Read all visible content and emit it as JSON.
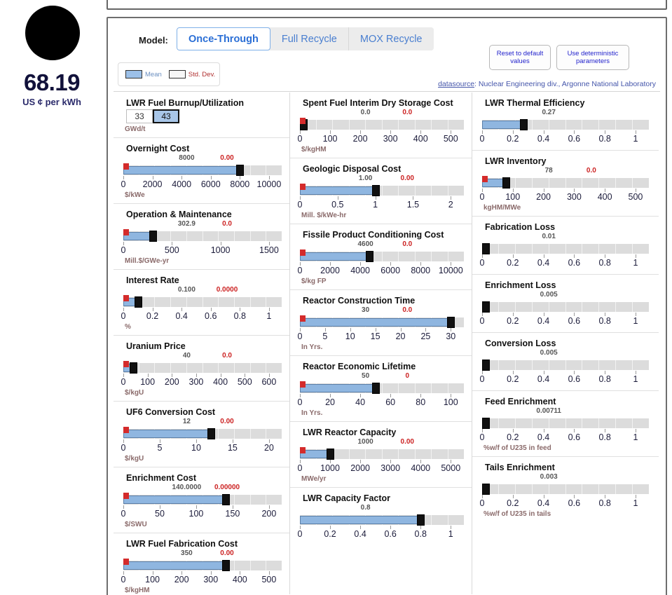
{
  "result": {
    "value": "68.19",
    "unit": "US ¢ per kWh"
  },
  "header": {
    "model_label": "Model:",
    "models": [
      {
        "label": "Once-Through",
        "active": true
      },
      {
        "label": "Full Recycle",
        "active": false
      },
      {
        "label": "MOX Recycle",
        "active": false
      }
    ],
    "reset_button": "Reset to default values",
    "deterministic_button": "Use deterministic parameters"
  },
  "legend": {
    "mean_label": "Mean",
    "stddev_label": "Std. Dev.",
    "mean_color": "#9cc0e8",
    "stddev_color": "#ffffff"
  },
  "datasource": {
    "link_text": "datasource",
    "text": ": Nuclear Engineering div., Argonne National Laboratory"
  },
  "chart_data": {
    "type": "bar",
    "title": "Nuclear Fuel Cycle Cost Parameters",
    "columns": [
      {
        "name": "column-1",
        "params": [
          {
            "title": "LWR Fuel Burnup/Utilization",
            "kind": "stepper",
            "options": [
              "33",
              "43"
            ],
            "selected": "43",
            "units": "GWd/t"
          },
          {
            "title": "Overnight Cost",
            "kind": "slider",
            "mean": "8000",
            "mean_num": 8000,
            "sd": "0.00",
            "sd_num": 0,
            "min": 0,
            "max": 10000,
            "ticks": [
              "0",
              "2000",
              "4000",
              "6000",
              "8000",
              "10000"
            ],
            "tick_vals": [
              0,
              2000,
              4000,
              6000,
              8000,
              10000
            ],
            "units": "$/kWe"
          },
          {
            "title": "Operation & Maintenance",
            "kind": "slider",
            "mean": "302.9",
            "mean_num": 302.9,
            "sd": "0.0",
            "sd_num": 0,
            "min": 0,
            "max": 1500,
            "ticks": [
              "0",
              "500",
              "1000",
              "1500"
            ],
            "tick_vals": [
              0,
              500,
              1000,
              1500
            ],
            "units": "Mill.$/GWe-yr"
          },
          {
            "title": "Interest Rate",
            "kind": "slider",
            "mean": "0.100",
            "mean_num": 0.1,
            "sd": "0.0000",
            "sd_num": 0,
            "min": 0,
            "max": 1,
            "ticks": [
              "0",
              "0.2",
              "0.4",
              "0.6",
              "0.8",
              "1"
            ],
            "tick_vals": [
              0,
              0.2,
              0.4,
              0.6,
              0.8,
              1
            ],
            "units": "%"
          },
          {
            "title": "Uranium Price",
            "kind": "slider",
            "mean": "40",
            "mean_num": 40,
            "sd": "0.0",
            "sd_num": 0,
            "min": 0,
            "max": 600,
            "ticks": [
              "0",
              "100",
              "200",
              "300",
              "400",
              "500",
              "600"
            ],
            "tick_vals": [
              0,
              100,
              200,
              300,
              400,
              500,
              600
            ],
            "units": "$/kgU"
          },
          {
            "title": "UF6 Conversion Cost",
            "kind": "slider",
            "mean": "12",
            "mean_num": 12,
            "sd": "0.00",
            "sd_num": 0,
            "min": 0,
            "max": 20,
            "ticks": [
              "0",
              "5",
              "10",
              "15",
              "20"
            ],
            "tick_vals": [
              0,
              5,
              10,
              15,
              20
            ],
            "units": "$/kgU"
          },
          {
            "title": "Enrichment Cost",
            "kind": "slider",
            "mean": "140.0000",
            "mean_num": 140,
            "sd": "0.00000",
            "sd_num": 0,
            "min": 0,
            "max": 200,
            "ticks": [
              "0",
              "50",
              "100",
              "150",
              "200"
            ],
            "tick_vals": [
              0,
              50,
              100,
              150,
              200
            ],
            "units": "$/SWU"
          },
          {
            "title": "LWR Fuel Fabrication Cost",
            "kind": "slider",
            "mean": "350",
            "mean_num": 350,
            "sd": "0.00",
            "sd_num": 0,
            "min": 0,
            "max": 500,
            "ticks": [
              "0",
              "100",
              "200",
              "300",
              "400",
              "500"
            ],
            "tick_vals": [
              0,
              100,
              200,
              300,
              400,
              500
            ],
            "units": "$/kgHM"
          }
        ]
      },
      {
        "name": "column-2",
        "params": [
          {
            "title": "Spent Fuel Interim Dry Storage Cost",
            "kind": "slider",
            "mean": "0.0",
            "mean_num": 0,
            "sd": "0.0",
            "sd_num": 0,
            "min": 0,
            "max": 500,
            "ticks": [
              "0",
              "100",
              "200",
              "300",
              "400",
              "500"
            ],
            "tick_vals": [
              0,
              100,
              200,
              300,
              400,
              500
            ],
            "units": "$/kgHM"
          },
          {
            "title": "Geologic Disposal Cost",
            "kind": "slider",
            "mean": "1.00",
            "mean_num": 1,
            "sd": "0.00",
            "sd_num": 0,
            "min": 0,
            "max": 2,
            "ticks": [
              "0",
              "0.5",
              "1",
              "1.5",
              "2"
            ],
            "tick_vals": [
              0,
              0.5,
              1,
              1.5,
              2
            ],
            "units": "Mill. $/kWe-hr"
          },
          {
            "title": "Fissile Product Conditioning Cost",
            "kind": "slider",
            "mean": "4600",
            "mean_num": 4600,
            "sd": "0.0",
            "sd_num": 0,
            "min": 0,
            "max": 10000,
            "ticks": [
              "0",
              "2000",
              "4000",
              "6000",
              "8000",
              "10000"
            ],
            "tick_vals": [
              0,
              2000,
              4000,
              6000,
              8000,
              10000
            ],
            "units": "$/kg FP"
          },
          {
            "title": "Reactor Construction Time",
            "kind": "slider",
            "mean": "30",
            "mean_num": 30,
            "sd": "0.0",
            "sd_num": 0,
            "min": 0,
            "max": 30,
            "ticks": [
              "0",
              "5",
              "10",
              "15",
              "20",
              "25",
              "30"
            ],
            "tick_vals": [
              0,
              5,
              10,
              15,
              20,
              25,
              30
            ],
            "units": "In Yrs."
          },
          {
            "title": "Reactor Economic Lifetime",
            "kind": "slider",
            "mean": "50",
            "mean_num": 50,
            "sd": "0",
            "sd_num": 0,
            "min": 0,
            "max": 100,
            "ticks": [
              "0",
              "20",
              "40",
              "60",
              "80",
              "100"
            ],
            "tick_vals": [
              0,
              20,
              40,
              60,
              80,
              100
            ],
            "units": "In Yrs."
          },
          {
            "title": "LWR Reactor Capacity",
            "kind": "slider",
            "mean": "1000",
            "mean_num": 1000,
            "sd": "0.00",
            "sd_num": 0,
            "min": 0,
            "max": 5000,
            "ticks": [
              "0",
              "1000",
              "2000",
              "3000",
              "4000",
              "5000"
            ],
            "tick_vals": [
              0,
              1000,
              2000,
              3000,
              4000,
              5000
            ],
            "units": "MWe/yr"
          },
          {
            "title": "LWR Capacity Factor",
            "kind": "slider",
            "mean": "0.8",
            "mean_num": 0.8,
            "sd": null,
            "sd_num": null,
            "min": 0,
            "max": 1,
            "ticks": [
              "0",
              "0.2",
              "0.4",
              "0.6",
              "0.8",
              "1"
            ],
            "tick_vals": [
              0,
              0.2,
              0.4,
              0.6,
              0.8,
              1
            ],
            "units": ""
          }
        ]
      },
      {
        "name": "column-3",
        "params": [
          {
            "title": "LWR Thermal Efficiency",
            "kind": "slider",
            "mean": "0.27",
            "mean_num": 0.27,
            "sd": null,
            "sd_num": null,
            "min": 0,
            "max": 1,
            "ticks": [
              "0",
              "0.2",
              "0.4",
              "0.6",
              "0.8",
              "1"
            ],
            "tick_vals": [
              0,
              0.2,
              0.4,
              0.6,
              0.8,
              1
            ],
            "units": ""
          },
          {
            "title": "LWR Inventory",
            "kind": "slider",
            "mean": "78",
            "mean_num": 78,
            "sd": "0.0",
            "sd_num": 0,
            "min": 0,
            "max": 500,
            "ticks": [
              "0",
              "100",
              "200",
              "300",
              "400",
              "500"
            ],
            "tick_vals": [
              0,
              100,
              200,
              300,
              400,
              500
            ],
            "units": "kgHM/MWe"
          },
          {
            "title": "Fabrication Loss",
            "kind": "slider",
            "mean": "0.01",
            "mean_num": 0.01,
            "sd": null,
            "sd_num": null,
            "min": 0,
            "max": 1,
            "ticks": [
              "0",
              "0.2",
              "0.4",
              "0.6",
              "0.8",
              "1"
            ],
            "tick_vals": [
              0,
              0.2,
              0.4,
              0.6,
              0.8,
              1
            ],
            "units": ""
          },
          {
            "title": "Enrichment Loss",
            "kind": "slider",
            "mean": "0.005",
            "mean_num": 0.005,
            "sd": null,
            "sd_num": null,
            "min": 0,
            "max": 1,
            "ticks": [
              "0",
              "0.2",
              "0.4",
              "0.6",
              "0.8",
              "1"
            ],
            "tick_vals": [
              0,
              0.2,
              0.4,
              0.6,
              0.8,
              1
            ],
            "units": ""
          },
          {
            "title": "Conversion Loss",
            "kind": "slider",
            "mean": "0.005",
            "mean_num": 0.005,
            "sd": null,
            "sd_num": null,
            "min": 0,
            "max": 1,
            "ticks": [
              "0",
              "0.2",
              "0.4",
              "0.6",
              "0.8",
              "1"
            ],
            "tick_vals": [
              0,
              0.2,
              0.4,
              0.6,
              0.8,
              1
            ],
            "units": ""
          },
          {
            "title": "Feed Enrichment",
            "kind": "slider",
            "mean": "0.00711",
            "mean_num": 0.00711,
            "sd": null,
            "sd_num": null,
            "min": 0,
            "max": 1,
            "ticks": [
              "0",
              "0.2",
              "0.4",
              "0.6",
              "0.8",
              "1"
            ],
            "tick_vals": [
              0,
              0.2,
              0.4,
              0.6,
              0.8,
              1
            ],
            "units": "%w/f of U235 in feed"
          },
          {
            "title": "Tails Enrichment",
            "kind": "slider",
            "mean": "0.003",
            "mean_num": 0.003,
            "sd": null,
            "sd_num": null,
            "min": 0,
            "max": 1,
            "ticks": [
              "0",
              "0.2",
              "0.4",
              "0.6",
              "0.8",
              "1"
            ],
            "tick_vals": [
              0,
              0.2,
              0.4,
              0.6,
              0.8,
              1
            ],
            "units": "%w/f of U235 in tails"
          }
        ]
      }
    ]
  }
}
